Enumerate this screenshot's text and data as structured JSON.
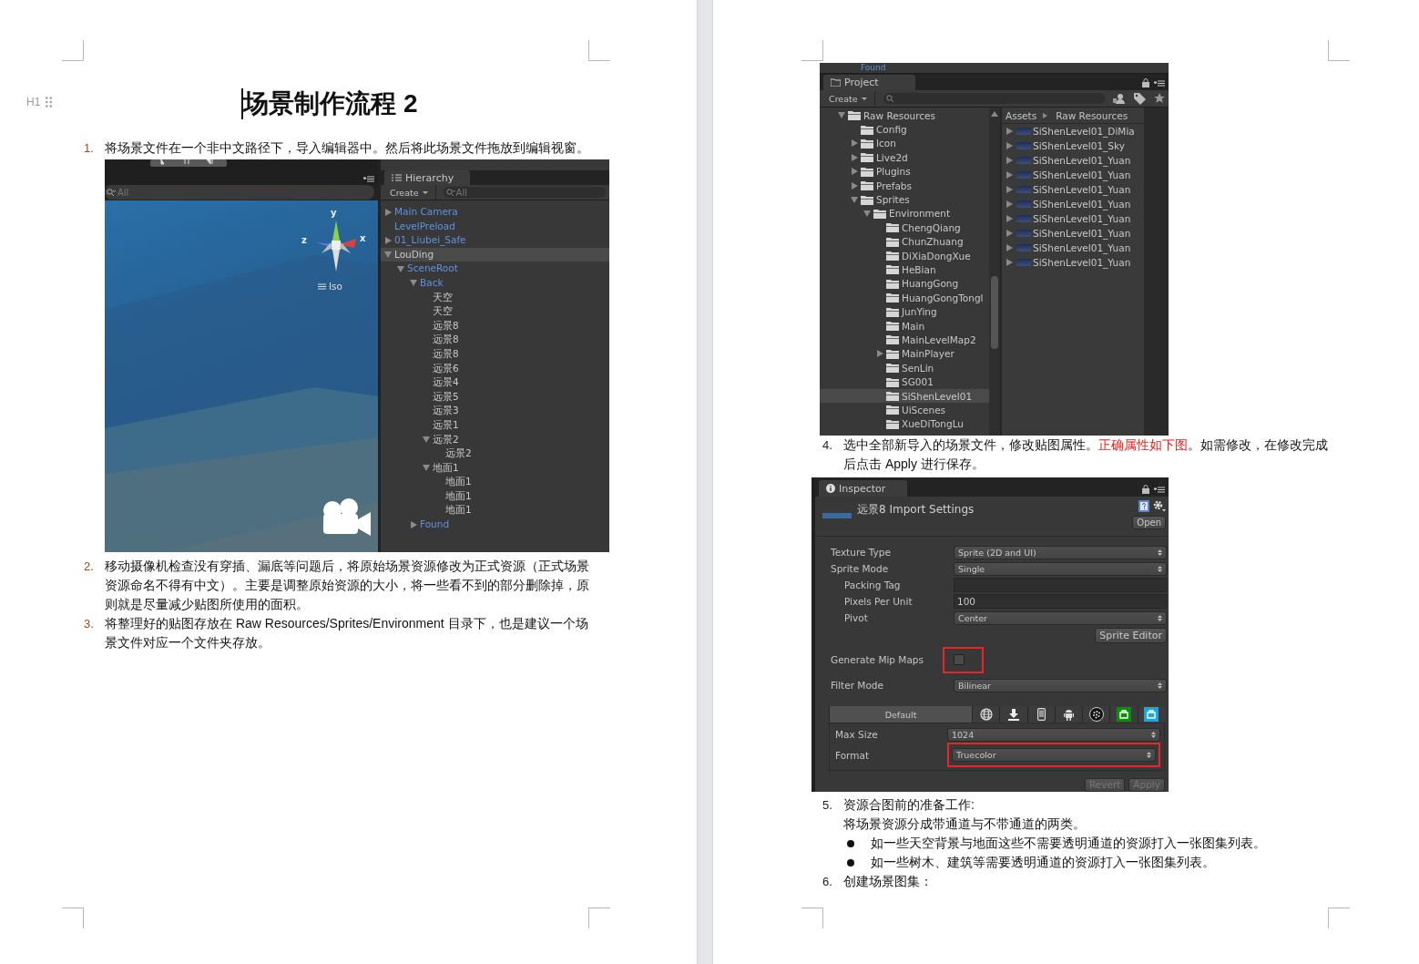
{
  "left_page": {
    "heading_marker": "H1",
    "title": "场景制作流程 2",
    "step_1": {
      "number": "1.",
      "text": "将场景文件在一个非中文路径下，导入编辑器中。然后将此场景文件拖放到编辑视窗。"
    },
    "screenshot": {
      "scene_search": "All",
      "gizmo_labels": [
        "y",
        "z",
        "x"
      ],
      "projection": "Iso",
      "hierarchy": {
        "tab": "Hierarchy",
        "create": "Create",
        "search": "All",
        "items": [
          {
            "name": "Main Camera",
            "kind": "prefab",
            "expanded": false,
            "selected": false
          },
          {
            "name": "LevelPreload",
            "kind": "prefab",
            "selected": false
          },
          {
            "name": "01_Liubei_Safe",
            "kind": "prefab",
            "expanded": false,
            "selected": false
          },
          {
            "name": "LouDing",
            "kind": "object",
            "expanded": true,
            "selected": true,
            "children": [
              {
                "name": "SceneRoot",
                "kind": "prefab",
                "expanded": true,
                "selected": false,
                "children": [
                  {
                    "name": "Back",
                    "kind": "prefab",
                    "expanded": true,
                    "selected": false,
                    "children": [
                      {
                        "name": "天空",
                        "kind": "object",
                        "selected": false
                      },
                      {
                        "name": "天空",
                        "kind": "object",
                        "selected": false
                      },
                      {
                        "name": "远景8",
                        "kind": "object",
                        "selected": false
                      },
                      {
                        "name": "远景8",
                        "kind": "object",
                        "selected": false
                      },
                      {
                        "name": "远景8",
                        "kind": "object",
                        "selected": false
                      },
                      {
                        "name": "远景6",
                        "kind": "object",
                        "selected": false
                      },
                      {
                        "name": "远景4",
                        "kind": "object",
                        "selected": false
                      },
                      {
                        "name": "远景5",
                        "kind": "object",
                        "selected": false
                      },
                      {
                        "name": "远景3",
                        "kind": "object",
                        "selected": false
                      },
                      {
                        "name": "远景1",
                        "kind": "object",
                        "selected": false
                      },
                      {
                        "name": "远景2",
                        "kind": "object",
                        "expanded": true,
                        "selected": false,
                        "children": [
                          {
                            "name": "远景2",
                            "kind": "object",
                            "selected": false
                          }
                        ]
                      },
                      {
                        "name": "地面1",
                        "kind": "object",
                        "expanded": true,
                        "selected": false,
                        "children": [
                          {
                            "name": "地面1",
                            "kind": "object",
                            "selected": false
                          },
                          {
                            "name": "地面1",
                            "kind": "object",
                            "selected": false
                          },
                          {
                            "name": "地面1",
                            "kind": "object",
                            "selected": false
                          }
                        ]
                      }
                    ]
                  },
                  {
                    "name": "Found",
                    "kind": "prefab",
                    "expanded": false,
                    "selected": false
                  }
                ]
              }
            ]
          }
        ]
      }
    },
    "steps": [
      {
        "number": "2.",
        "text": "移动摄像机检查没有穿插、漏底等问题后，将原始场景资源修改为正式资源（正式场景资源命名不得有中文）。主要是调整原始资源的大小，将一些看不到的部分删除掉，原则就是尽量减少贴图所使用的面积。"
      },
      {
        "number": "3.",
        "text": "将整理好的贴图存放在 Raw Resources/Sprites/Environment 目录下，也是建议一个场景文件对应一个文件夹存放。"
      }
    ]
  },
  "right_page": {
    "project_screenshot": {
      "cut_label": "Found",
      "tab": "Project",
      "create": "Create",
      "breadcrumb": [
        "Assets",
        "Raw Resources"
      ],
      "folders": [
        {
          "name": "Raw Resources",
          "expanded": true,
          "selected": false,
          "children": [
            {
              "name": "Config",
              "selected": false
            },
            {
              "name": "Icon",
              "expanded": false,
              "selected": false
            },
            {
              "name": "Live2d",
              "expanded": false,
              "selected": false
            },
            {
              "name": "Plugins",
              "expanded": false,
              "selected": false
            },
            {
              "name": "Prefabs",
              "expanded": false,
              "selected": false
            },
            {
              "name": "Sprites",
              "expanded": true,
              "selected": false,
              "children": [
                {
                  "name": "Environment",
                  "expanded": true,
                  "selected": false,
                  "children": [
                    {
                      "name": "ChengQiang",
                      "selected": false
                    },
                    {
                      "name": "ChunZhuang",
                      "selected": false
                    },
                    {
                      "name": "DiXiaDongXue",
                      "selected": false
                    },
                    {
                      "name": "HeBian",
                      "selected": false
                    },
                    {
                      "name": "HuangGong",
                      "selected": false
                    },
                    {
                      "name": "HuangGongTongl",
                      "selected": false
                    },
                    {
                      "name": "JunYing",
                      "selected": false
                    },
                    {
                      "name": "Main",
                      "selected": false
                    },
                    {
                      "name": "MainLevelMap2",
                      "selected": false
                    },
                    {
                      "name": "MainPlayer",
                      "expanded": false,
                      "selected": false
                    },
                    {
                      "name": "SenLin",
                      "selected": false
                    },
                    {
                      "name": "SG001",
                      "selected": false
                    },
                    {
                      "name": "SiShenLevel01",
                      "selected": true
                    },
                    {
                      "name": "UiScenes",
                      "selected": false
                    },
                    {
                      "name": "XueDiTongLu",
                      "selected": false
                    }
                  ]
                }
              ]
            }
          ]
        }
      ],
      "assets": [
        {
          "name": "SiShenLevel01_DiMia"
        },
        {
          "name": "SiShenLevel01_Sky"
        },
        {
          "name": "SiShenLevel01_Yuan"
        },
        {
          "name": "SiShenLevel01_Yuan"
        },
        {
          "name": "SiShenLevel01_Yuan"
        },
        {
          "name": "SiShenLevel01_Yuan"
        },
        {
          "name": "SiShenLevel01_Yuan"
        },
        {
          "name": "SiShenLevel01_Yuan"
        },
        {
          "name": "SiShenLevel01_Yuan"
        },
        {
          "name": "SiShenLevel01_Yuan"
        }
      ]
    },
    "step_4": {
      "number": "4.",
      "segments": [
        {
          "text": "选中全部新导入的场景文件，修改贴图属性。",
          "emphasis": false
        },
        {
          "text": "正确属性如下图",
          "emphasis": true
        },
        {
          "text": "。如需修改，在修改完成后点击 Apply 进行保存。",
          "emphasis": false
        }
      ]
    },
    "inspector_screenshot": {
      "tab": "Inspector",
      "title": "远景8 Import Settings",
      "open_button": "Open",
      "fields": [
        {
          "label": "Texture Type",
          "kind": "dropdown",
          "value": "Sprite (2D and UI)",
          "highlighted": false
        },
        {
          "label": "Sprite Mode",
          "kind": "dropdown",
          "value": "Single",
          "highlighted": false,
          "children": [
            {
              "label": "Packing Tag",
              "kind": "text",
              "highlighted": false
            },
            {
              "label": "Pixels Per Unit",
              "kind": "text",
              "value": "100",
              "highlighted": false
            },
            {
              "label": "Pivot",
              "kind": "dropdown",
              "value": "Center",
              "highlighted": false
            }
          ]
        },
        {
          "kind": "button",
          "value": "Sprite Editor",
          "highlighted": false
        },
        {
          "label": "Generate Mip Maps",
          "kind": "checkbox",
          "checked": false,
          "highlighted": true
        },
        {
          "label": "Filter Mode",
          "kind": "dropdown",
          "value": "Bilinear",
          "highlighted": false
        }
      ],
      "platform_tabs": [
        {
          "kind": "text",
          "label": "Default",
          "selected": true
        },
        {
          "kind": "globe",
          "selected": false
        },
        {
          "kind": "download",
          "selected": false
        },
        {
          "kind": "phone",
          "selected": false
        },
        {
          "kind": "android",
          "selected": false
        },
        {
          "kind": "blackberry",
          "selected": false
        },
        {
          "kind": "store",
          "color": "#0b8f0b",
          "selected": false
        },
        {
          "kind": "store",
          "color": "#1ba6e0",
          "selected": false
        }
      ],
      "platform_fields": [
        {
          "label": "Max Size",
          "kind": "dropdown",
          "value": "1024",
          "highlighted": false
        },
        {
          "label": "Format",
          "kind": "dropdown",
          "value": "Truecolor",
          "highlighted": true
        }
      ],
      "buttons": [
        {
          "label": "Revert",
          "disabled": true
        },
        {
          "label": "Apply",
          "disabled": true
        }
      ]
    },
    "step_5": {
      "number": "5.",
      "text": "资源合图前的准备工作:",
      "note": "将场景资源分成带通道与不带通道的两类。",
      "bullets": [
        "如一些天空背景与地面这些不需要透明通道的资源打入一张图集列表。",
        "如一些树木、建筑等需要透明通道的资源打入一张图集列表。"
      ]
    },
    "step_6": {
      "number": "6.",
      "text": "创建场景图集："
    }
  }
}
